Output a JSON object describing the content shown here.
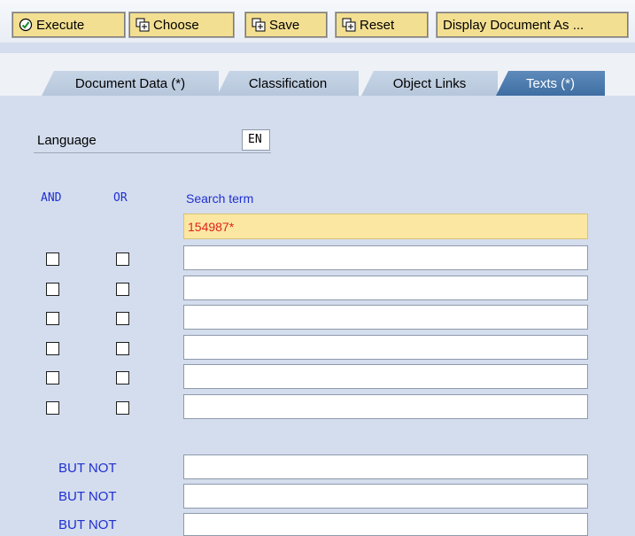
{
  "toolbar": {
    "execute_label": "Execute",
    "choose_label": "Choose",
    "save_label": "Save",
    "reset_label": "Reset",
    "display_label": "Display Document As ..."
  },
  "tabs": [
    {
      "label": "Document Data (*)",
      "active": false
    },
    {
      "label": "Classification",
      "active": false
    },
    {
      "label": "Object Links",
      "active": false
    },
    {
      "label": "Texts (*)",
      "active": true
    }
  ],
  "language": {
    "label": "Language",
    "value": "EN"
  },
  "search": {
    "and_label": "AND",
    "or_label": "OR",
    "term_label": "Search term",
    "first_term": "154987*",
    "rows": [
      {
        "and": false,
        "or": false,
        "term": ""
      },
      {
        "and": false,
        "or": false,
        "term": ""
      },
      {
        "and": false,
        "or": false,
        "term": ""
      },
      {
        "and": false,
        "or": false,
        "term": ""
      },
      {
        "and": false,
        "or": false,
        "term": ""
      },
      {
        "and": false,
        "or": false,
        "term": ""
      }
    ]
  },
  "but_not": [
    {
      "label": "BUT NOT",
      "term": ""
    },
    {
      "label": "BUT NOT",
      "term": ""
    },
    {
      "label": "BUT NOT",
      "term": ""
    }
  ],
  "colors": {
    "accent_blue": "#1f2fd2",
    "highlight_field": "#fbe7a1",
    "value_red": "#e0231c"
  }
}
